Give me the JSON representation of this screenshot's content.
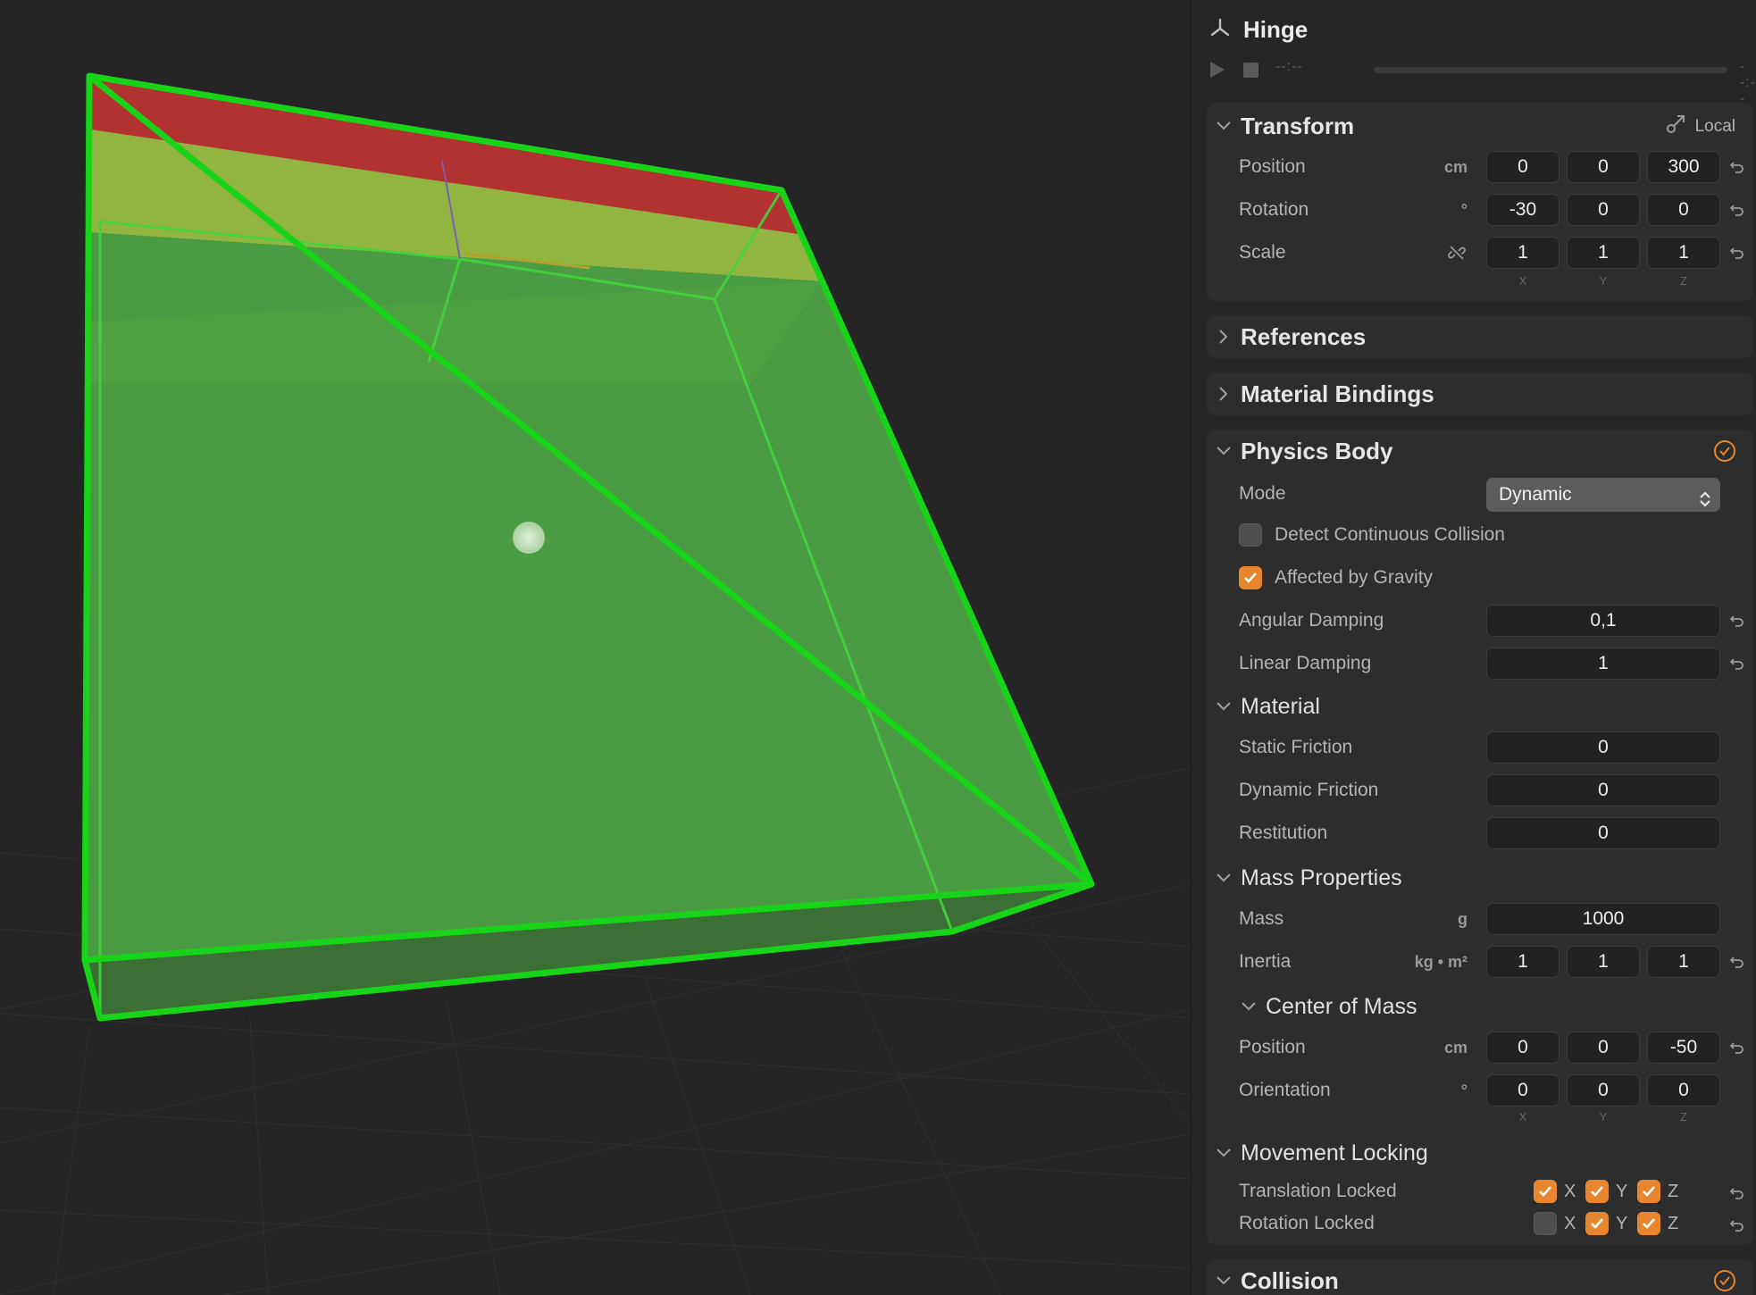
{
  "inspector": {
    "title": "Hinge",
    "player": {
      "time_start": "--:--",
      "time_end": "--:--"
    },
    "transform": {
      "label": "Transform",
      "space_label": "Local",
      "position": {
        "label": "Position",
        "unit": "cm",
        "x": "0",
        "y": "0",
        "z": "300"
      },
      "rotation": {
        "label": "Rotation",
        "unit": "°",
        "x": "-30",
        "y": "0",
        "z": "0"
      },
      "scale": {
        "label": "Scale",
        "x": "1",
        "y": "1",
        "z": "1"
      },
      "axis": {
        "x": "X",
        "y": "Y",
        "z": "Z"
      }
    },
    "references": {
      "label": "References"
    },
    "material_bindings": {
      "label": "Material Bindings"
    },
    "physics_body": {
      "label": "Physics Body",
      "enabled": true,
      "mode": {
        "label": "Mode",
        "value": "Dynamic"
      },
      "detect_continuous_collision": {
        "label": "Detect Continuous Collision",
        "checked": false
      },
      "affected_by_gravity": {
        "label": "Affected by Gravity",
        "checked": true
      },
      "angular_damping": {
        "label": "Angular Damping",
        "value": "0,1"
      },
      "linear_damping": {
        "label": "Linear Damping",
        "value": "1"
      },
      "material": {
        "label": "Material",
        "static_friction": {
          "label": "Static Friction",
          "value": "0"
        },
        "dynamic_friction": {
          "label": "Dynamic Friction",
          "value": "0"
        },
        "restitution": {
          "label": "Restitution",
          "value": "0"
        }
      },
      "mass_properties": {
        "label": "Mass Properties",
        "mass": {
          "label": "Mass",
          "unit": "g",
          "value": "1000"
        },
        "inertia": {
          "label": "Inertia",
          "unit": "kg • m²",
          "x": "1",
          "y": "1",
          "z": "1"
        },
        "center_of_mass": {
          "label": "Center of Mass",
          "position": {
            "label": "Position",
            "unit": "cm",
            "x": "0",
            "y": "0",
            "z": "-50"
          },
          "orientation": {
            "label": "Orientation",
            "unit": "°",
            "x": "0",
            "y": "0",
            "z": "0"
          }
        }
      },
      "movement_locking": {
        "label": "Movement Locking",
        "translation": {
          "label": "Translation Locked",
          "x": true,
          "y": true,
          "z": true
        },
        "rotation": {
          "label": "Rotation Locked",
          "x": false,
          "y": true,
          "z": true
        }
      }
    },
    "collision": {
      "label": "Collision",
      "enabled": true
    }
  },
  "colors": {
    "accent": "#e8852f",
    "selection_outline": "#1fd21f",
    "body_fill": "#4caf44",
    "top_face": "#b03030"
  }
}
